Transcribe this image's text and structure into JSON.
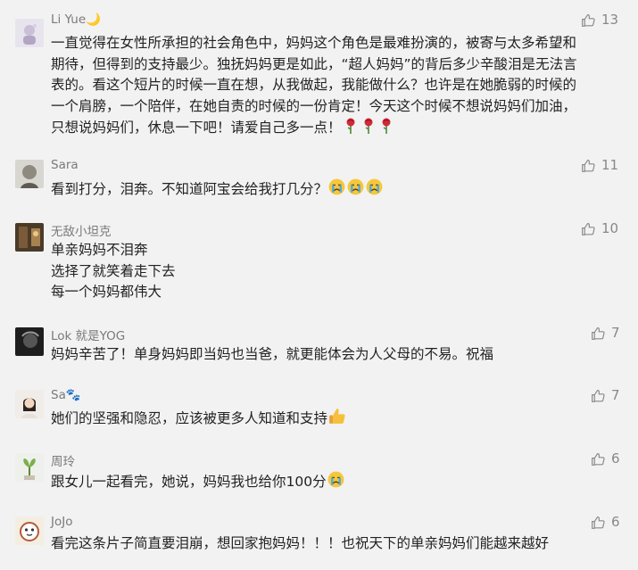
{
  "comments": [
    {
      "name": "Li Yue🌙",
      "likes": "13",
      "lines": [
        "一直觉得在女性所承担的社会角色中，妈妈这个角色是最难扮演的，被寄与太多希望和",
        "期待，但得到的支持最少。独抚妈妈更是如此，“超人妈妈”的背后多少辛酸泪是无法言",
        "表的。看这个短片的时候一直在想，从我做起，我能做什么？也许是在她脆弱的时候的",
        "一个肩膀，一个陪伴，在她自责的时候的一份肯定！今天这个时候不想说妈妈们加油，",
        "只想说妈妈们，休息一下吧！请爱自己多一点！"
      ],
      "emoji": [
        "rose",
        "rose",
        "rose"
      ]
    },
    {
      "name": "Sara",
      "likes": "11",
      "lines": [
        "看到打分，泪奔。不知道阿宝会给我打几分？"
      ],
      "emoji": [
        "crying-face",
        "crying-face",
        "crying-face"
      ]
    },
    {
      "name": "无敌小坦克",
      "likes": "10",
      "lines": [
        "单亲妈妈不泪奔",
        "选择了就笑着走下去",
        "每一个妈妈都伟大"
      ],
      "emoji": []
    },
    {
      "name": "Lok 就是YOG",
      "likes": "7",
      "lines": [
        "妈妈辛苦了！单身妈妈即当妈也当爸，就更能体会为人父母的不易。祝福"
      ],
      "emoji": []
    },
    {
      "name": "Sa🐾",
      "likes": "7",
      "lines": [
        "她们的坚强和隐忍，应该被更多人知道和支持"
      ],
      "emoji": [
        "thumbs-up"
      ]
    },
    {
      "name": "周玲",
      "likes": "6",
      "lines": [
        "跟女儿一起看完，她说，妈妈我也给你100分"
      ],
      "emoji": [
        "crying-face"
      ]
    },
    {
      "name": "JoJo",
      "likes": "6",
      "lines": [
        "看完这条片子简直要泪崩，想回家抱妈妈！！！也祝天下的单亲妈妈们能越来越好"
      ],
      "emoji": []
    }
  ],
  "colors": {
    "background": "#f2f2f2",
    "name": "#7a7a7a",
    "text": "#222222",
    "like": "#888888"
  }
}
